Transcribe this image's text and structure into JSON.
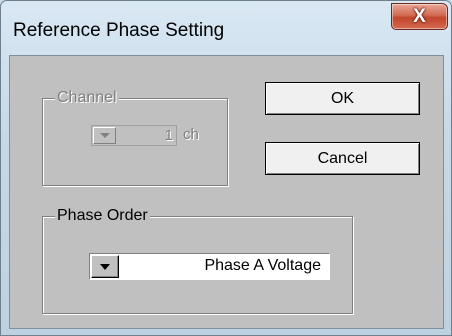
{
  "window": {
    "title": "Reference Phase Setting",
    "close_glyph": "X"
  },
  "channel": {
    "group_label": "Channel",
    "value": "1",
    "unit": "ch",
    "enabled": false
  },
  "buttons": {
    "ok_label": "OK",
    "cancel_label": "Cancel"
  },
  "phase_order": {
    "group_label": "Phase Order",
    "selected": "Phase A Voltage"
  },
  "colors": {
    "dialog_face": "#c0c0c0",
    "close_button": "#c2462c",
    "disabled_text": "#808080"
  }
}
